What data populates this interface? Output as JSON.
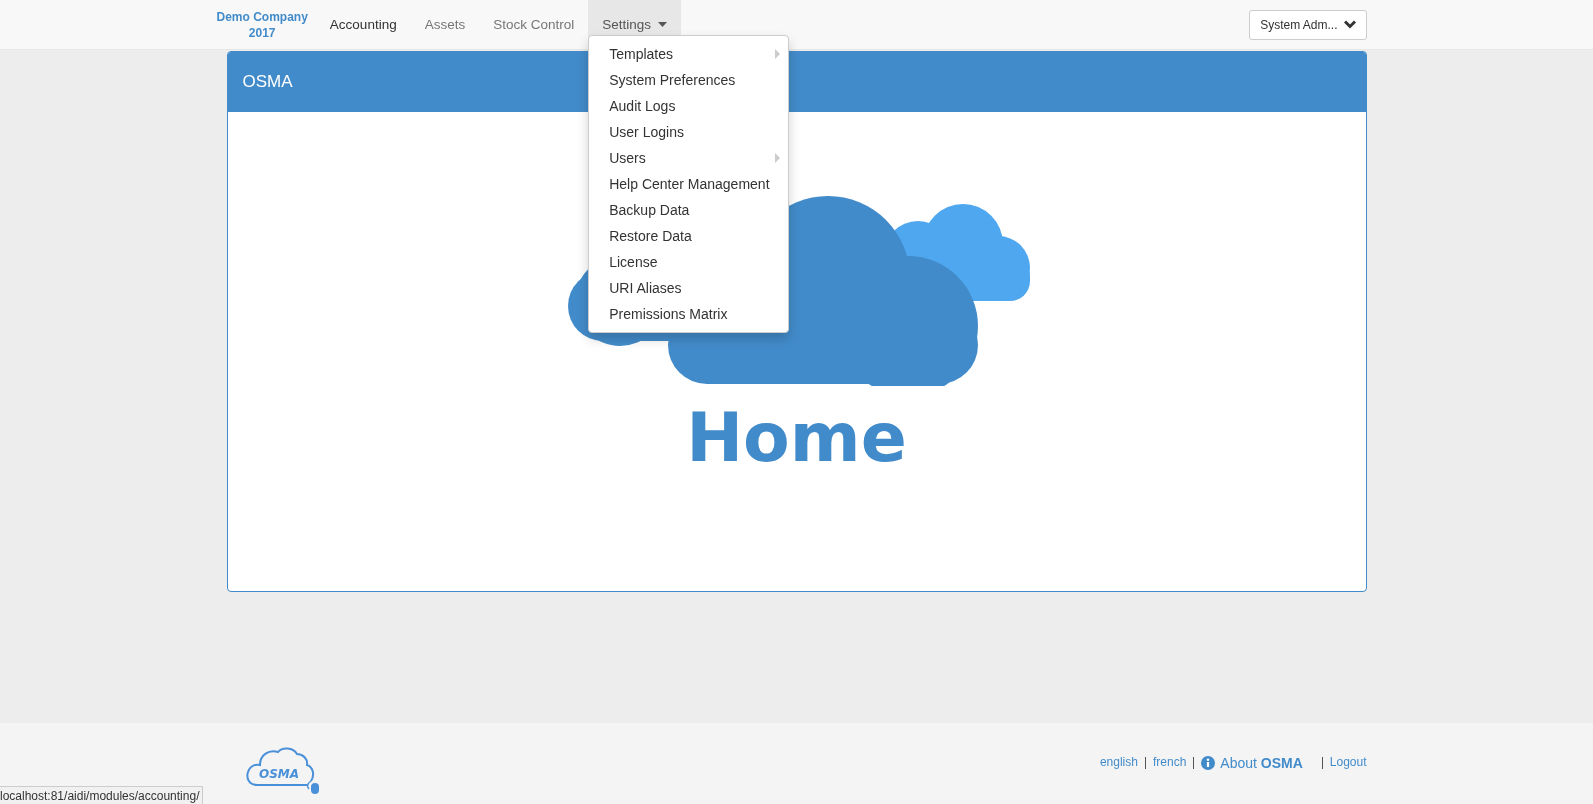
{
  "navbar": {
    "brand": [
      "Demo Company",
      "2017"
    ],
    "items": [
      {
        "label": "Accounting",
        "emphasized": true,
        "selected": false,
        "has_caret": false
      },
      {
        "label": "Assets",
        "emphasized": false,
        "selected": false,
        "has_caret": false
      },
      {
        "label": "Stock Control",
        "emphasized": false,
        "selected": false,
        "has_caret": false
      },
      {
        "label": "Settings",
        "emphasized": false,
        "selected": true,
        "has_caret": true
      }
    ],
    "user_button": "System Adm..."
  },
  "settings_menu": [
    {
      "label": "Templates",
      "has_submenu": true
    },
    {
      "label": "System Preferences",
      "has_submenu": false
    },
    {
      "label": "Audit Logs",
      "has_submenu": false
    },
    {
      "label": "User Logins",
      "has_submenu": false
    },
    {
      "label": "Users",
      "has_submenu": true
    },
    {
      "label": "Help Center Management",
      "has_submenu": false
    },
    {
      "label": "Backup Data",
      "has_submenu": false
    },
    {
      "label": "Restore Data",
      "has_submenu": false
    },
    {
      "label": "License",
      "has_submenu": false
    },
    {
      "label": "URI Aliases",
      "has_submenu": false
    },
    {
      "label": "Premissions Matrix",
      "has_submenu": false
    }
  ],
  "panel": {
    "title": "OSMA",
    "home_label": "Home"
  },
  "footer": {
    "logo_text": "OSMA",
    "links": [
      {
        "label": "english",
        "kind": "link"
      },
      {
        "label": "french",
        "kind": "link"
      },
      {
        "label": "About **OSMA**",
        "kind": "info"
      },
      {
        "label": "Logout",
        "kind": "link"
      }
    ]
  },
  "status_bar": "localhost:81/aidi/modules/accounting/"
}
